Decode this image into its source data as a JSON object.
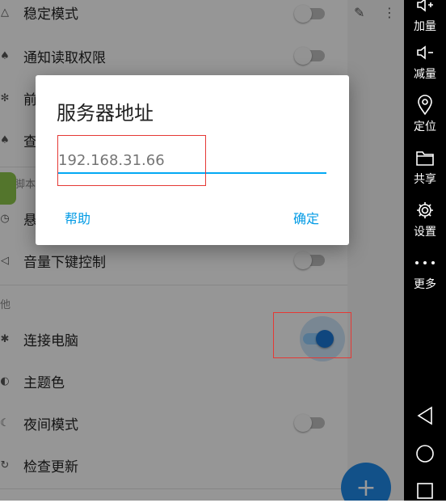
{
  "settings": {
    "rows": [
      {
        "label": "稳定模式",
        "icon": "triangle-icon"
      },
      {
        "label": "通知读取权限",
        "icon": "bell-icon"
      },
      {
        "label": "前",
        "icon": "gear-icon"
      },
      {
        "label": "查",
        "icon": "bell-icon"
      },
      {
        "label": "悬",
        "icon": "clock-icon"
      },
      {
        "label": "音量下键控制",
        "icon": "volume-icon"
      },
      {
        "label": "连接电脑",
        "icon": "bug-icon"
      },
      {
        "label": "主题色",
        "icon": "palette-icon"
      },
      {
        "label": "夜间模式",
        "icon": "moon-icon"
      },
      {
        "label": "检查更新",
        "icon": "refresh-icon"
      }
    ],
    "section_script": "脚本",
    "section_other": "他",
    "toggles": {
      "stable": false,
      "notify": false,
      "volume": false,
      "connect_pc": true,
      "night": false
    }
  },
  "fab": {
    "symbol": "+"
  },
  "dialog": {
    "title": "服务器地址",
    "input_value": "192.168.31.66",
    "help_label": "帮助",
    "confirm_label": "确定"
  },
  "sidebar": {
    "items": [
      {
        "label": "加量",
        "icon": "volume-up-icon"
      },
      {
        "label": "减量",
        "icon": "volume-down-icon"
      },
      {
        "label": "定位",
        "icon": "location-pin-icon"
      },
      {
        "label": "共享",
        "icon": "folder-icon"
      },
      {
        "label": "设置",
        "icon": "gear-icon"
      },
      {
        "label": "更多",
        "icon": "more-dots-icon"
      }
    ],
    "nav": [
      "back-icon",
      "home-icon",
      "recents-icon"
    ]
  },
  "colors": {
    "accent": "#03a9f4",
    "toggle_on": "#1976d2",
    "highlight": "#e53935"
  }
}
